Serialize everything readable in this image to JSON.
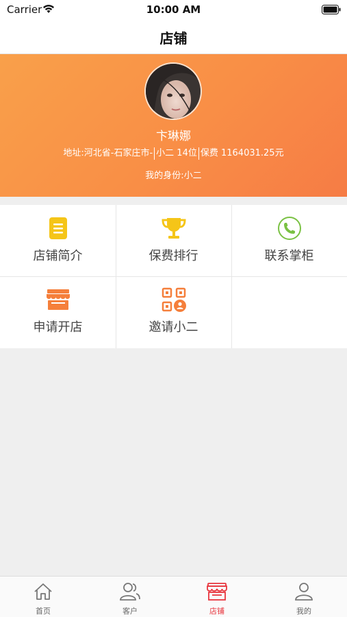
{
  "status_bar": {
    "carrier": "Carrier",
    "time": "10:00 AM"
  },
  "nav": {
    "title": "店铺"
  },
  "profile": {
    "name": "卞琳娜",
    "address": "地址:河北省-石家庄市-",
    "rank": "小二 14位",
    "fee": "保费 1164031.25元",
    "identity": "我的身份:小二"
  },
  "grid": {
    "items": [
      {
        "label": "店铺简介",
        "icon": "document-icon",
        "color": "#f5c518"
      },
      {
        "label": "保费排行",
        "icon": "trophy-icon",
        "color": "#f5c518"
      },
      {
        "label": "联系掌柜",
        "icon": "phone-icon",
        "color": "#7ac143"
      },
      {
        "label": "申请开店",
        "icon": "storefront-icon",
        "color": "#f57f3b"
      },
      {
        "label": "邀请小二",
        "icon": "qr-invite-icon",
        "color": "#f57f3b"
      }
    ]
  },
  "tabbar": {
    "items": [
      {
        "label": "首页",
        "icon": "home-icon",
        "active": false
      },
      {
        "label": "客户",
        "icon": "users-icon",
        "active": false
      },
      {
        "label": "店铺",
        "icon": "store-icon",
        "active": true
      },
      {
        "label": "我的",
        "icon": "person-icon",
        "active": false
      }
    ],
    "active_color": "#e8353d",
    "inactive_color": "#666666"
  },
  "colors": {
    "banner_start": "#f9a04a",
    "banner_end": "#f67c45"
  }
}
